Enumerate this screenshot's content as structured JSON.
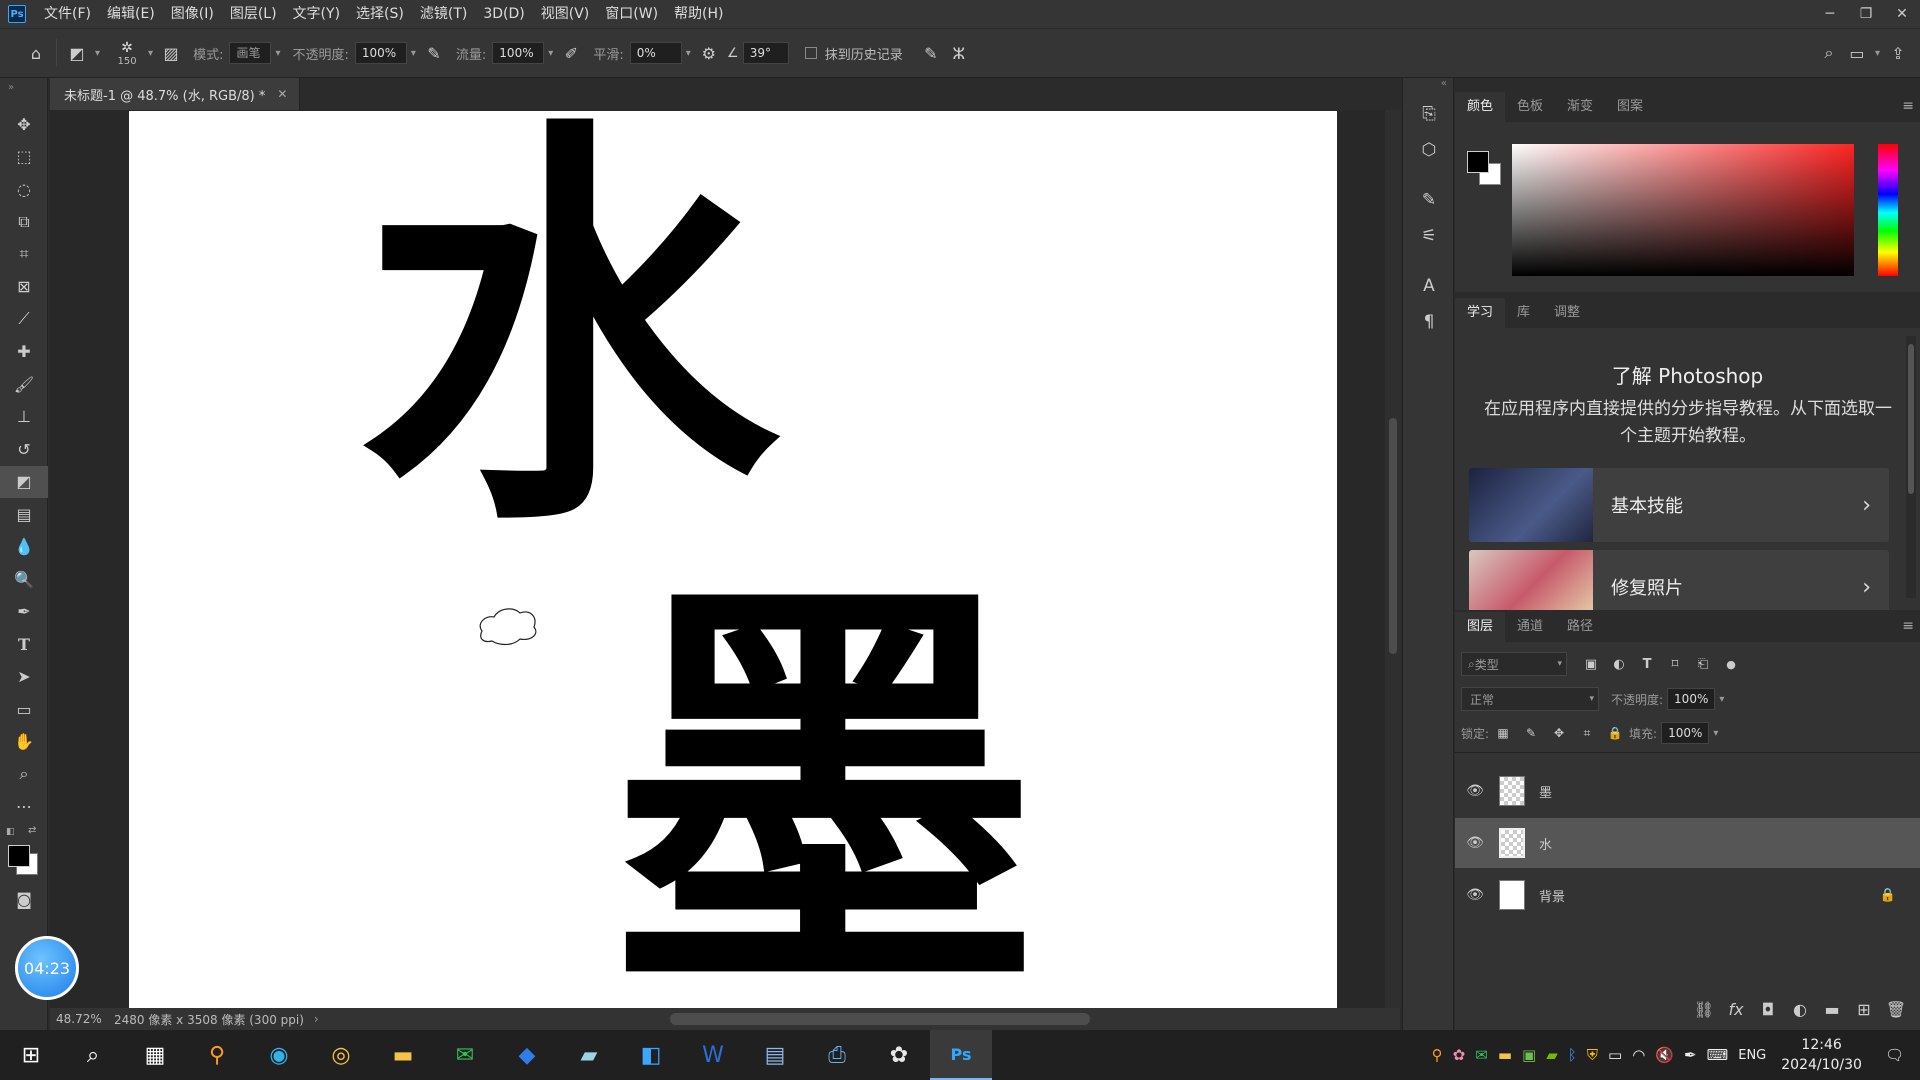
{
  "app": {
    "logo": "Ps"
  },
  "menu": [
    "文件(F)",
    "编辑(E)",
    "图像(I)",
    "图层(L)",
    "文字(Y)",
    "选择(S)",
    "滤镜(T)",
    "3D(D)",
    "视图(V)",
    "窗口(W)",
    "帮助(H)"
  ],
  "options": {
    "brush_size": "150",
    "mode_label": "模式:",
    "mode_value": "画笔",
    "opacity_label": "不透明度:",
    "opacity_value": "100%",
    "flow_label": "流量:",
    "flow_value": "100%",
    "smooth_label": "平滑:",
    "smooth_value": "0%",
    "angle_value": "39°",
    "erase_history_label": "抹到历史记录"
  },
  "document": {
    "tab_title": "未标题-1 @ 48.7% (水, RGB/8) *",
    "char_water": "水",
    "char_ink": "墨"
  },
  "status": {
    "zoom": "48.72%",
    "info": "2480 像素 x 3508 像素 (300 ppi)"
  },
  "color_panel": {
    "tabs": [
      "颜色",
      "色板",
      "渐变",
      "图案"
    ],
    "fg_color": "#000000",
    "bg_color": "#ffffff"
  },
  "learn_panel": {
    "tabs": [
      "学习",
      "库",
      "调整"
    ],
    "title": "了解 Photoshop",
    "description": "在应用程序内直接提供的分步指导教程。从下面选取一个主题开始教程。",
    "cards": [
      "基本技能",
      "修复照片"
    ]
  },
  "layers_panel": {
    "tabs": [
      "图层",
      "通道",
      "路径"
    ],
    "filter_kind": "类型",
    "blend_mode": "正常",
    "opacity_label": "不透明度:",
    "opacity_value": "100%",
    "lock_label": "锁定:",
    "fill_label": "填充:",
    "fill_value": "100%",
    "layers": [
      {
        "name": "墨",
        "selected": false,
        "locked": false
      },
      {
        "name": "水",
        "selected": true,
        "locked": false
      },
      {
        "name": "背景",
        "selected": false,
        "locked": true
      }
    ]
  },
  "timer": "04:23",
  "taskbar": {
    "lang": "ENG",
    "time": "12:46",
    "date": "2024/10/30"
  }
}
